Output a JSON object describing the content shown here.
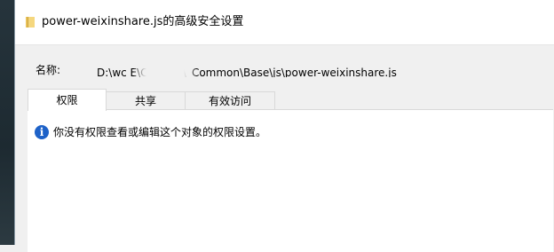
{
  "window": {
    "title": "power-weixinshare.js的高级安全设置",
    "icon": "folder-icon"
  },
  "object_name": {
    "label": "名称:",
    "value": "D:\\wc         E\\Content\\_Common\\Base\\js\\power-weixinshare.js"
  },
  "tabs": [
    {
      "label": "权限",
      "active": true
    },
    {
      "label": "共享",
      "active": false
    },
    {
      "label": "有效访问",
      "active": false
    }
  ],
  "message": {
    "icon": "info-icon",
    "text": "你没有权限查看或编辑这个对象的权限设置。"
  },
  "colors": {
    "info_icon": "#1e62c8",
    "folder_icon": "#e8c15a"
  }
}
